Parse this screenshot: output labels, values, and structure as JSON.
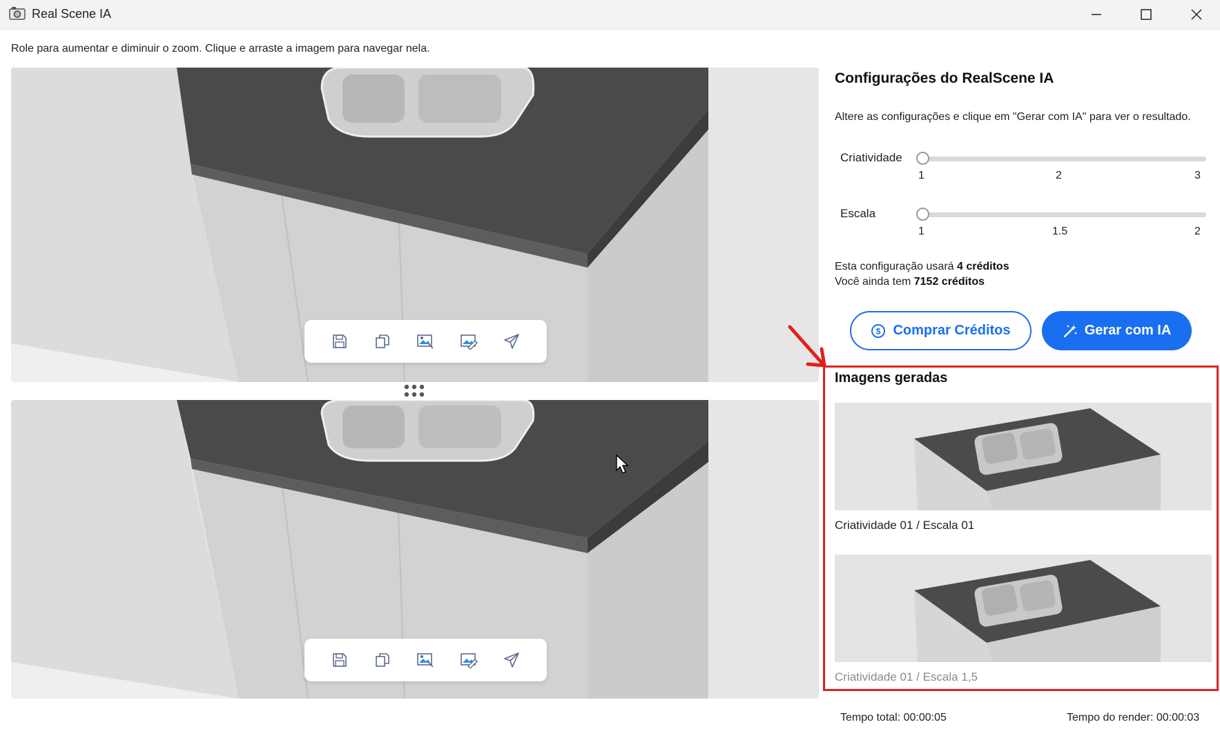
{
  "window": {
    "title": "Real Scene IA"
  },
  "instructions": "Role para aumentar e diminuir o zoom. Clique e arraste a imagem para navegar nela.",
  "toolbar_icons": [
    "save-icon",
    "copy-icon",
    "image-compare-icon",
    "image-edit-icon",
    "send-icon"
  ],
  "settings": {
    "title": "Configurações do RealScene IA",
    "description": "Altere as configurações e clique em \"Gerar com IA\" para ver o resultado.",
    "creativity": {
      "label": "Criatividade",
      "ticks": [
        "1",
        "2",
        "3"
      ],
      "value": 1,
      "min": 1,
      "max": 3
    },
    "scale": {
      "label": "Escala",
      "ticks": [
        "1",
        "1.5",
        "2"
      ],
      "value": 1,
      "min": 1,
      "max": 2
    },
    "credits_use_prefix": "Esta configuração usará",
    "credits_use_value": "4 créditos",
    "credits_left_prefix": "Você ainda tem",
    "credits_left_value": "7152 créditos",
    "buy_label": "Comprar Créditos",
    "generate_label": "Gerar com IA"
  },
  "generated": {
    "title": "Imagens geradas",
    "items": [
      {
        "caption": "Criatividade 01 / Escala 01"
      },
      {
        "caption": "Criatividade 01 / Escala 1,5"
      }
    ]
  },
  "footer": {
    "total_time": "Tempo total: 00:00:05",
    "render_time": "Tempo do render: 00:00:03"
  },
  "colors": {
    "accent": "#1a6ff0",
    "highlight": "#e02020"
  }
}
